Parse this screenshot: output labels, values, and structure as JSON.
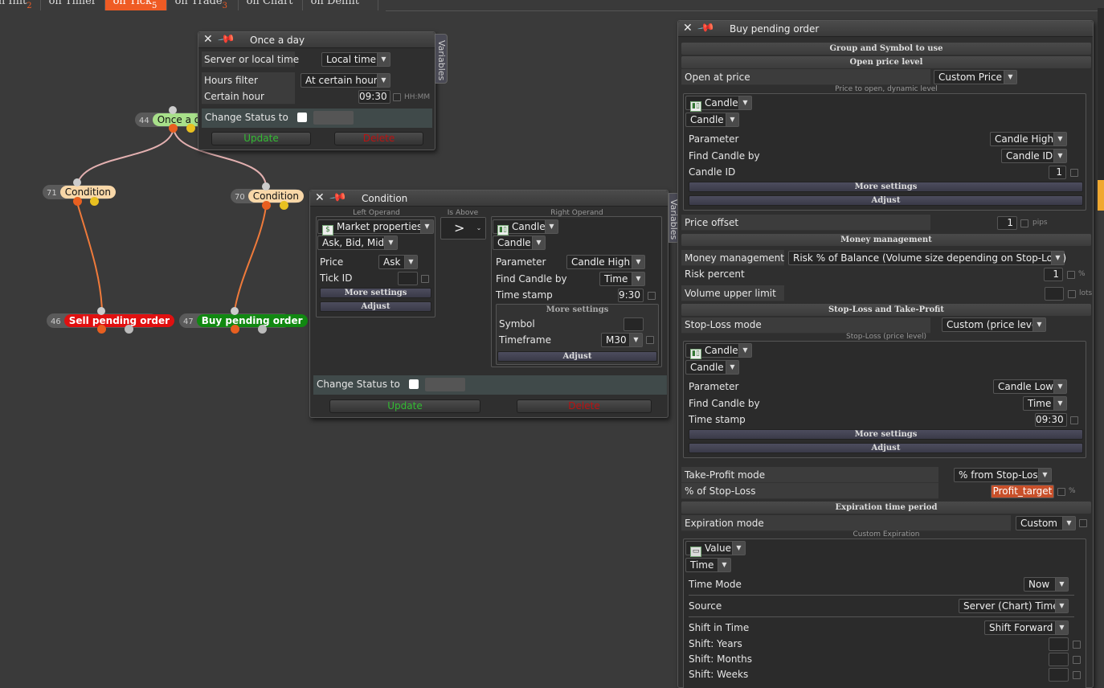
{
  "tabs": [
    {
      "label": "on Init",
      "count": "2"
    },
    {
      "label": "on Timer",
      "count": ""
    },
    {
      "label": "on Tick",
      "count": "5"
    },
    {
      "label": "on Trade",
      "count": "3"
    },
    {
      "label": "on Chart",
      "count": ""
    },
    {
      "label": "on Deinit",
      "count": ""
    }
  ],
  "nodes": {
    "once": {
      "id": "44",
      "name": "Once a day"
    },
    "cond71": {
      "id": "71",
      "name": "Condition"
    },
    "cond70": {
      "id": "70",
      "name": "Condition"
    },
    "sell": {
      "id": "46",
      "name": "Sell pending order"
    },
    "buy": {
      "id": "47",
      "name": "Buy pending order"
    }
  },
  "once_window": {
    "title": "Once a day",
    "variables_tab": "Variables",
    "server_local_label": "Server or local time",
    "server_local_value": "Local time",
    "hours_filter_label": "Hours filter",
    "hours_filter_value": "At certain hour",
    "certain_hour_label": "Certain hour",
    "certain_hour_value": "09:30",
    "certain_hour_hint": "HH:MM",
    "change_status_label": "Change Status to",
    "update": "Update",
    "delete": "Delete"
  },
  "condition_window": {
    "title": "Condition",
    "variables_tab": "Variables",
    "left_operand_caption": "Left Operand",
    "comparator_caption": "Is Above",
    "right_operand_caption": "Right Operand",
    "left_source": "Market properties",
    "left_sub": "Ask, Bid, Mid",
    "price_label": "Price",
    "price_value": "Ask",
    "tick_id_label": "Tick ID",
    "comparator": ">",
    "right_source": "Candle",
    "right_sub": "Candle",
    "parameter_label": "Parameter",
    "parameter_value": "Candle High",
    "find_by_label": "Find Candle by",
    "find_by_value": "Time",
    "timestamp_label": "Time stamp",
    "timestamp_value": "9:30",
    "more_settings": "More settings",
    "adjust": "Adjust",
    "symbol_label": "Symbol",
    "timeframe_label": "Timeframe",
    "timeframe_value": "M30",
    "change_status_label": "Change Status to",
    "update": "Update",
    "delete": "Delete"
  },
  "buy_window": {
    "title": "Buy pending order",
    "group_symbol": "Group and Symbol to use",
    "open_price_level": "Open price level",
    "open_at_price_label": "Open at price",
    "open_at_price_value": "Custom Price",
    "price_dyn_caption": "Price to open, dynamic level",
    "candle_source": "Candle",
    "candle_sub": "Candle",
    "parameter_label": "Parameter",
    "parameter_value": "Candle High",
    "find_by_label": "Find Candle by",
    "find_by_value": "Candle ID",
    "candle_id_label": "Candle ID",
    "candle_id_value": "1",
    "more_settings": "More settings",
    "adjust": "Adjust",
    "price_offset_label": "Price offset",
    "price_offset_value": "1",
    "pips": "pips",
    "money_mgmt_section": "Money management",
    "money_mgmt_label": "Money management",
    "money_mgmt_value": "Risk % of Balance (Volume size depending on Stop-Loss)",
    "risk_label": "Risk percent",
    "risk_value": "1",
    "percent": "%",
    "vol_upper_label": "Volume upper limit",
    "lots": "lots",
    "sltp_section": "Stop-Loss and Take-Profit",
    "sl_mode_label": "Stop-Loss mode",
    "sl_mode_value": "Custom (price level)",
    "sl_caption": "Stop-Loss (price level)",
    "sl_candle_source": "Candle",
    "sl_candle_sub": "Candle",
    "sl_parameter_value": "Candle Low",
    "sl_find_by_value": "Time",
    "sl_timestamp_label": "Time stamp",
    "sl_timestamp_value": "09:30",
    "tp_mode_label": "Take-Profit mode",
    "tp_mode_value": "% from Stop-Loss",
    "tp_pct_label": "% of Stop-Loss",
    "tp_pct_value": "Profit_target",
    "expiration_section": "Expiration time period",
    "exp_mode_label": "Expiration mode",
    "exp_mode_value": "Custom",
    "custom_exp_caption": "Custom Expiration",
    "exp_source": "Value",
    "exp_sub": "Time",
    "time_mode_label": "Time Mode",
    "time_mode_value": "Now",
    "source_label": "Source",
    "source_value": "Server (Chart) Time",
    "shift_label": "Shift in Time",
    "shift_value": "Shift Forward",
    "years_label": "Shift: Years",
    "months_label": "Shift: Months",
    "weeks_label": "Shift: Weeks"
  },
  "colors": {
    "accent": "#ef5b24",
    "sell": "#e01010",
    "buy": "#118811",
    "once": "#a8e08a",
    "condition": "#f8d7a8",
    "update": "#33bb33",
    "delete": "#bb1111"
  }
}
